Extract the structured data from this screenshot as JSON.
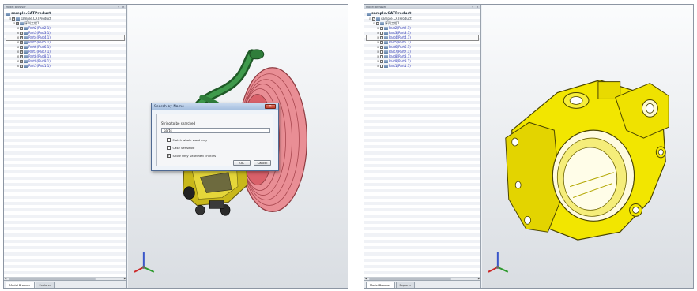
{
  "panels": [
    {
      "browser_title": "Model Browser",
      "tree": {
        "root_label": "sample.CATProduct",
        "product_label": "sample.CATProduct",
        "group_label": "序列工程1",
        "parts": [
          {
            "label": "Part2(Part2.1)",
            "checked": true,
            "selected": false
          },
          {
            "label": "Part3(Part3.1)",
            "checked": true,
            "selected": false
          },
          {
            "label": "Part4(Part4.1)",
            "checked": true,
            "selected": true
          },
          {
            "label": "Part5(Part5.1)",
            "checked": true,
            "selected": false
          },
          {
            "label": "Part6(Part6.1)",
            "checked": true,
            "selected": false
          },
          {
            "label": "Part7(Part7.1)",
            "checked": true,
            "selected": false
          },
          {
            "label": "Part8(Part8.1)",
            "checked": true,
            "selected": false
          },
          {
            "label": "Part9(Part9.1)",
            "checked": true,
            "selected": false
          },
          {
            "label": "Part1(Part1.1)",
            "checked": true,
            "selected": false
          }
        ]
      },
      "tabs": [
        "Model Browser",
        "Explorer"
      ]
    },
    {
      "browser_title": "Model Browser",
      "tree": {
        "root_label": "sample.CATProduct",
        "product_label": "sample.CATProduct",
        "group_label": "序列工程1",
        "parts": [
          {
            "label": "Part2(Part2.1)",
            "checked": false,
            "selected": false
          },
          {
            "label": "Part3(Part3.1)",
            "checked": false,
            "selected": false
          },
          {
            "label": "Part4(Part4.1)",
            "checked": true,
            "selected": true
          },
          {
            "label": "Part5(Part5.1)",
            "checked": false,
            "selected": false
          },
          {
            "label": "Part6(Part6.1)",
            "checked": false,
            "selected": false
          },
          {
            "label": "Part7(Part7.1)",
            "checked": false,
            "selected": false
          },
          {
            "label": "Part8(Part8.1)",
            "checked": false,
            "selected": false
          },
          {
            "label": "Part9(Part9.1)",
            "checked": false,
            "selected": false
          },
          {
            "label": "Part1(Part1.1)",
            "checked": false,
            "selected": false
          }
        ]
      },
      "tabs": [
        "Model Browser",
        "Explorer"
      ]
    }
  ],
  "dialog": {
    "title": "Search by Name",
    "field_label": "String to be searched",
    "field_value": "part4",
    "options": [
      {
        "label": "Match whole word only",
        "checked": false
      },
      {
        "label": "Case Sensitive",
        "checked": false
      },
      {
        "label": "Show Only Searched Entities",
        "checked": true
      }
    ],
    "ok_label": "OK",
    "cancel_label": "Cancel"
  },
  "icons": {
    "close": "close-icon",
    "pin": "pin-icon",
    "tree_node": "part-icon",
    "product": "product-icon",
    "axis": "axis-triad-icon"
  },
  "colors": {
    "part_label": "#2a35b5",
    "part_yellow": "#f2e600",
    "pulley_red": "#d9616a",
    "hose_green": "#2f7d3a"
  }
}
